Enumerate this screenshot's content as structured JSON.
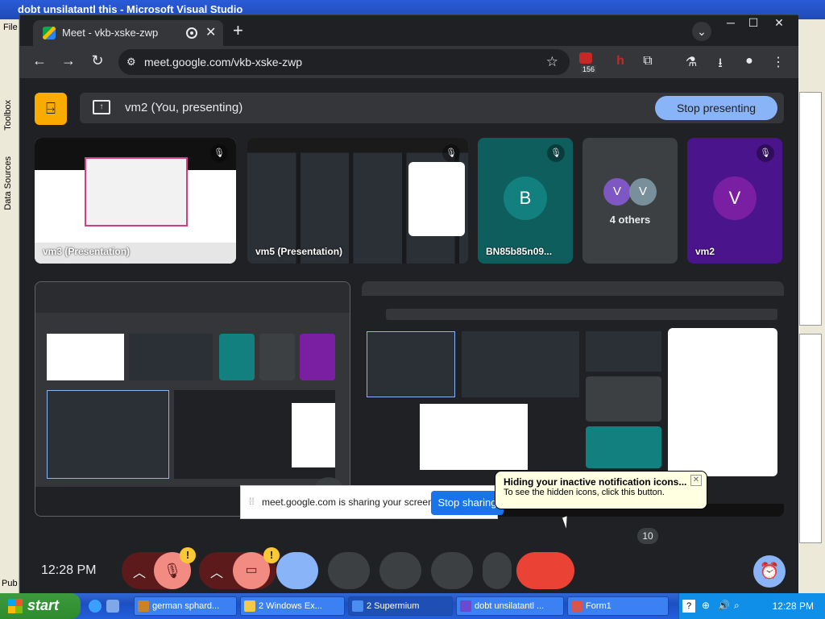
{
  "desktop": {
    "vs_title": "dobt unsilatantl this - Microsoft Visual Studio",
    "vs_menu_file": "File",
    "toolbox_label": "Toolbox",
    "datasources_label": "Data Sources",
    "pub_label": "Pub"
  },
  "browser": {
    "tab_title": "Meet - vkb-xske-zwp",
    "new_tab": "+",
    "url": "meet.google.com/vkb-xske-zwp",
    "ext_badge": "156"
  },
  "meet": {
    "presenting_label": "vm2 (You, presenting)",
    "stop_presenting": "Stop presenting",
    "tiles": [
      {
        "name": "vm3 (Presentation)"
      },
      {
        "name": "vm5 (Presentation)"
      },
      {
        "name": "BN85b85n09...",
        "initial": "B",
        "color": "#12807f"
      },
      {
        "name": "4 others",
        "initials": [
          "V",
          "V"
        ]
      },
      {
        "name": "vm2",
        "initial": "V",
        "color": "#7b1fa2"
      }
    ],
    "clock": "12:28 PM",
    "badge": "!",
    "count": "10"
  },
  "share_banner": {
    "text": "meet.google.com is sharing your screen.",
    "stop_sharing": "Stop sharing"
  },
  "tray_tip": {
    "title": "Hiding your inactive notification icons...",
    "body": "To see the hidden icons, click this button."
  },
  "taskbar": {
    "start": "start",
    "tasks": [
      {
        "label": "german sphard...",
        "color": "#c9822b"
      },
      {
        "label": "2 Windows Ex...",
        "color": "#f3c94a"
      },
      {
        "label": "2 Supermium",
        "color": "#4a8cf0"
      },
      {
        "label": "dobt unsilatantl ...",
        "color": "#6a4bd0"
      },
      {
        "label": "Form1",
        "color": "#d9534f"
      }
    ],
    "time": "12:28 PM"
  }
}
